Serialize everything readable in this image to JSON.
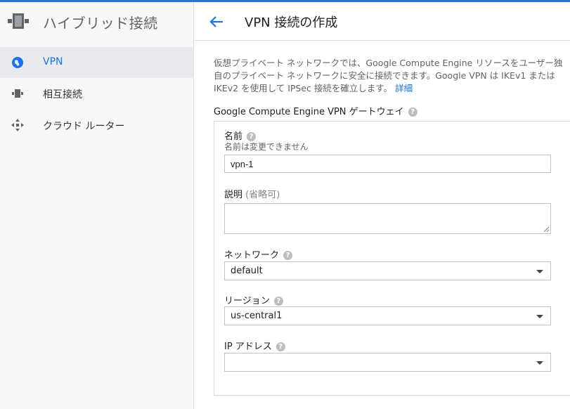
{
  "sidebar": {
    "title": "ハイブリッド接続",
    "items": [
      {
        "label": "VPN",
        "active": true
      },
      {
        "label": "相互接続",
        "active": false
      },
      {
        "label": "クラウド ルーター",
        "active": false
      }
    ]
  },
  "header": {
    "title": "VPN 接続の作成"
  },
  "main": {
    "description_1": "仮想プライベート ネットワークでは、Google Compute Engine リソースをユーザー独自のプライベート ネットワークに安全に接続できます。Google VPN は IKEv1 または IKEv2 を使用して IPSec 接続を確立します。",
    "learn_more": "詳細",
    "section_title": "Google Compute Engine VPN ゲートウェイ",
    "name": {
      "label": "名前",
      "sub": "名前は変更できません",
      "value": "vpn-1"
    },
    "description": {
      "label": "説明",
      "optional": "(省略可)",
      "value": ""
    },
    "network": {
      "label": "ネットワーク",
      "value": "default"
    },
    "region": {
      "label": "リージョン",
      "value": "us-central1"
    },
    "ip_address": {
      "label": "IP アドレス",
      "value": ""
    }
  },
  "colors": {
    "accent": "#1a73e8",
    "topline": "#2b6fdb"
  }
}
